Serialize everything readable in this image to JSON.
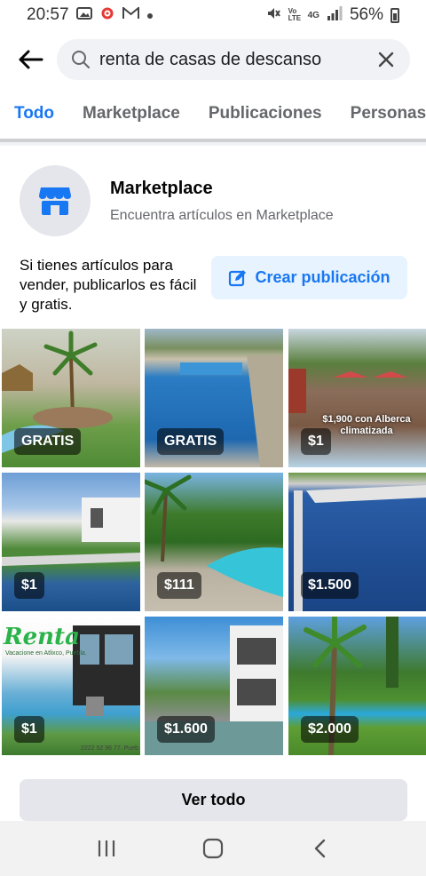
{
  "status_bar": {
    "time": "20:57",
    "battery": "56%",
    "notif_icons": [
      "photo-icon",
      "settings-icon",
      "gmail-icon",
      "dot-icon"
    ],
    "system_icons": [
      "mute-icon",
      "volte-icon",
      "4g-icon",
      "signal-icon",
      "battery-icon"
    ],
    "volte_label": "Vo LTE",
    "net_label": "4G"
  },
  "search": {
    "query": "renta de casas de descanso"
  },
  "tabs": [
    {
      "label": "Todo",
      "active": true
    },
    {
      "label": "Marketplace",
      "active": false
    },
    {
      "label": "Publicaciones",
      "active": false
    },
    {
      "label": "Personas",
      "active": false
    }
  ],
  "marketplace": {
    "title": "Marketplace",
    "subtitle": "Encuentra artículos en Marketplace",
    "sell_text": "Si tienes artículos para vender, publicarlos es fácil y gratis.",
    "create_label": "Crear publicación",
    "see_all_label": "Ver todo"
  },
  "listings": [
    {
      "price": "GRATIS",
      "overlay": ""
    },
    {
      "price": "GRATIS",
      "overlay": ""
    },
    {
      "price": "$1",
      "overlay": "$1,900 con Alberca climatizada"
    },
    {
      "price": "$1",
      "overlay": ""
    },
    {
      "price": "$111",
      "overlay": ""
    },
    {
      "price": "$1.500",
      "overlay": ""
    },
    {
      "price": "$1",
      "overlay": "Renta",
      "overlay_sub": "Vacacione en Atlixco, Puebla.",
      "phone": "2222 52 96 77. Pueb"
    },
    {
      "price": "$1.600",
      "overlay": ""
    },
    {
      "price": "$2.000",
      "overlay": ""
    }
  ],
  "colors": {
    "accent": "#1877f2",
    "tab_underline": "#1877f2",
    "create_bg": "#e7f3ff",
    "button_gray": "#e4e6eb"
  }
}
